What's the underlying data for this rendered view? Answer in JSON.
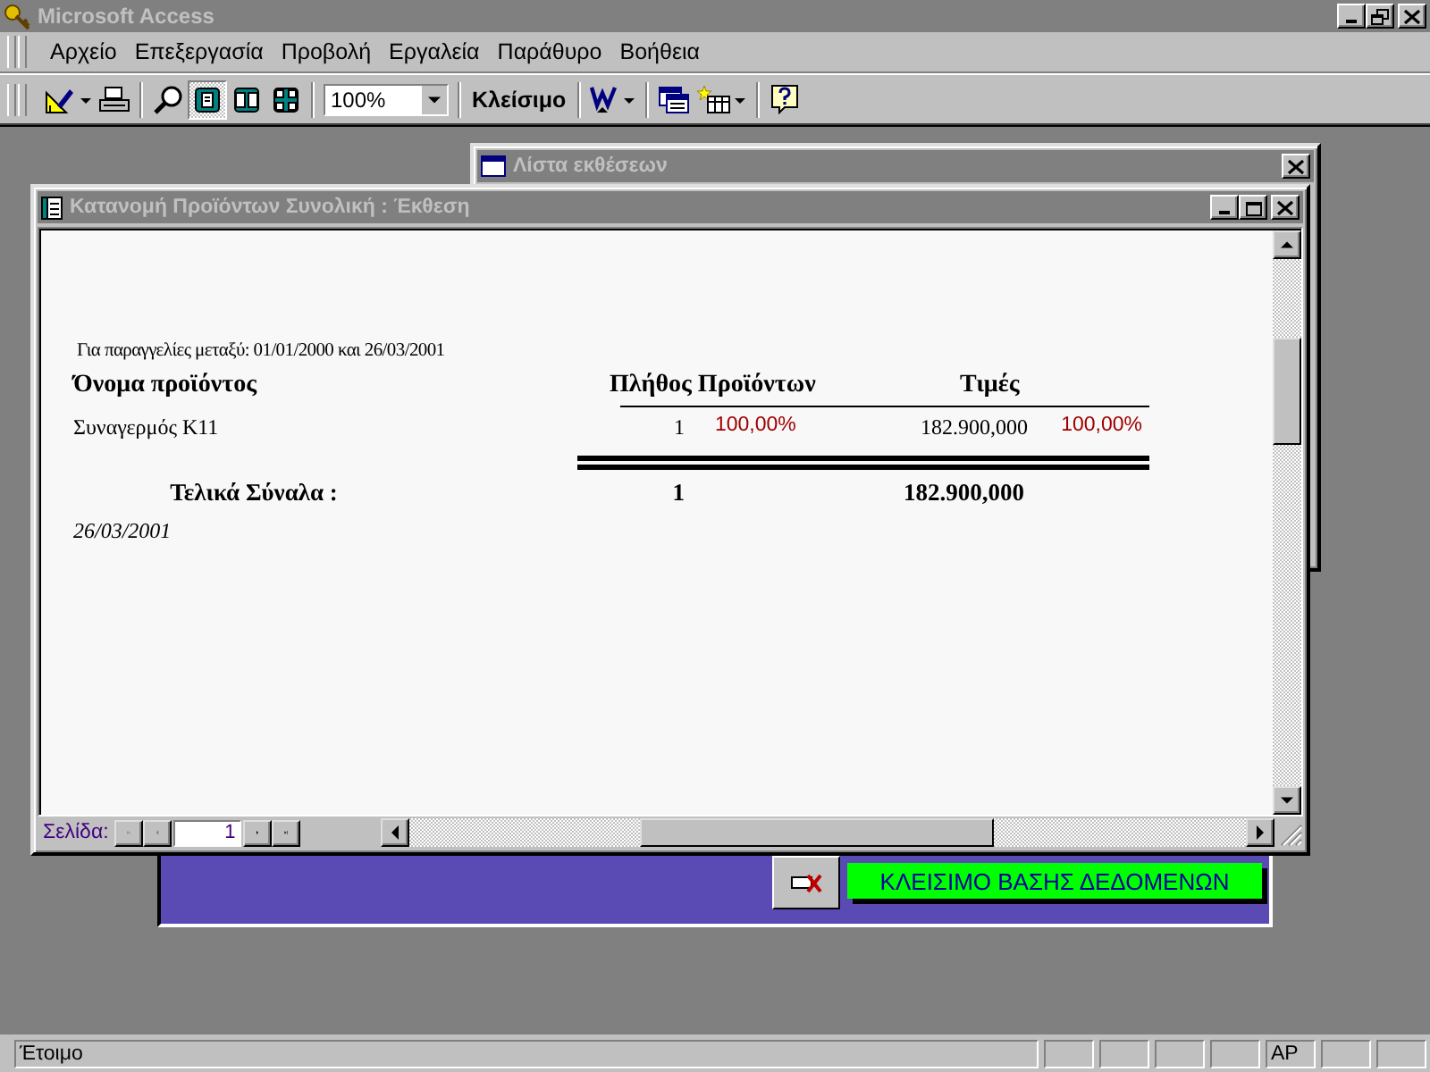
{
  "app": {
    "title": "Microsoft Access"
  },
  "menu": [
    {
      "label": "Αρχείο"
    },
    {
      "label": "Επεξεργασία"
    },
    {
      "label": "Προβολή"
    },
    {
      "label": "Εργαλεία"
    },
    {
      "label": "Παράθυρο"
    },
    {
      "label": "Βοήθεια"
    }
  ],
  "toolbar": {
    "view_buttons": [
      {
        "selected": true
      },
      {
        "selected": false
      },
      {
        "selected": false
      }
    ],
    "zoom": "100%",
    "close_label": "Κλείσιμο"
  },
  "background_window": {
    "title": "Λίστα εκθέσεων"
  },
  "switchboard": {
    "button_label": "ΚΛΕΙΣΙΜΟ ΒΑΣΗΣ ΔΕΔΟΜΕΝΩΝ"
  },
  "report_window": {
    "title": "Κατανομή Προϊόντων Συνολική : Έκθεση",
    "report": {
      "subtitle": "Για παραγγελίες μεταξύ: 01/01/2000 και 26/03/2001",
      "columns": [
        "Όνομα προϊόντος",
        "Πλήθος Προϊόντων",
        "Τιμές"
      ],
      "rows": [
        {
          "product": "Συναγερμός Κ11",
          "quantity": "1",
          "quantity_percent": "100,00%",
          "price": "182.900,000",
          "price_percent": "100,00%"
        }
      ],
      "totals": {
        "label": "Τελικά Σύναλα :",
        "quantity": "1",
        "price": "182.900,000"
      },
      "date": "26/03/2001"
    },
    "navigation": {
      "label": "Σελίδα:",
      "page": "1"
    }
  },
  "status_bar": {
    "message": "Έτοιμο",
    "indicators": [
      {
        "label": "ΑΡ"
      }
    ]
  }
}
